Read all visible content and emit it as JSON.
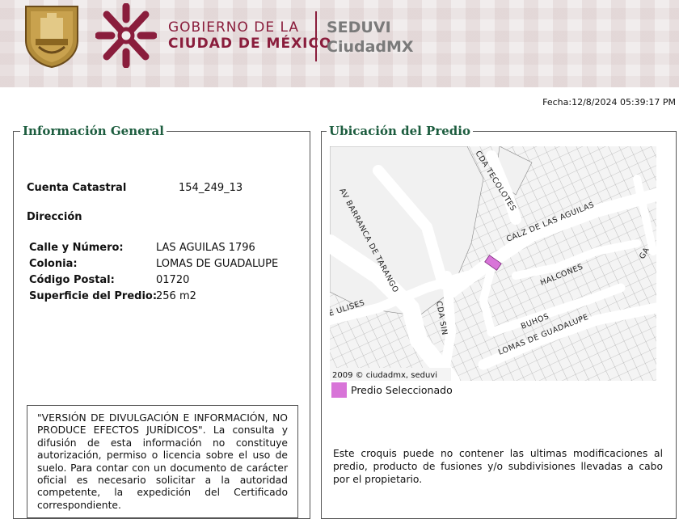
{
  "header": {
    "gov_line1": "GOBIERNO DE LA",
    "gov_line2": "CIUDAD DE MÉXICO",
    "agency_line1": "SEDUVI",
    "agency_line2": "CiudadMX"
  },
  "fecha": "Fecha:12/8/2024 05:39:17 PM",
  "info_general": {
    "title": "Información General",
    "cuenta_label": "Cuenta Catastral",
    "cuenta_value": "154_249_13",
    "direccion_label": "Dirección",
    "calle_label": "Calle y Número:",
    "calle_value": "LAS AGUILAS 1796",
    "colonia_label": "Colonia:",
    "colonia_value": "LOMAS DE GUADALUPE",
    "cp_label": "Código Postal:",
    "cp_value": "01720",
    "superficie_label": "Superficie del Predio:",
    "superficie_value": "256 m2",
    "notice": "\"VERSIÓN DE DIVULGACIÓN E INFORMACIÓN, NO PRODUCE EFECTOS JURÍDICOS\". La consulta y difusión de esta información no constituye autorización, permiso o licencia sobre el uso de suelo. Para contar con un documento de carácter oficial es necesario solicitar a la autoridad competente, la expedición del Certificado correspondiente."
  },
  "ubicacion": {
    "title": "Ubicación del Predio",
    "streets": {
      "cda_tecolotes": "CDA TECOLOTES",
      "calz_aguilas": "CALZ DE LAS AGUILAS",
      "barranca": "AV BARRANCA DE TARANGO",
      "halcones": "HALCONES",
      "ulises": "E ULISES",
      "cda_sin": "CDA SIN",
      "buhos": "BUHOS",
      "lomas": "LOMAS DE GUADALUPE",
      "ga": "GA"
    },
    "copyright": "2009 © ciudadmx, seduvi",
    "legend_label": "Predio Seleccionado",
    "legend_color": "#d874d8",
    "disclaimer": "Este croquis puede no contener las ultimas modificaciones al predio, producto de fusiones y/o subdivisiones llevadas a cabo por el propietario."
  }
}
